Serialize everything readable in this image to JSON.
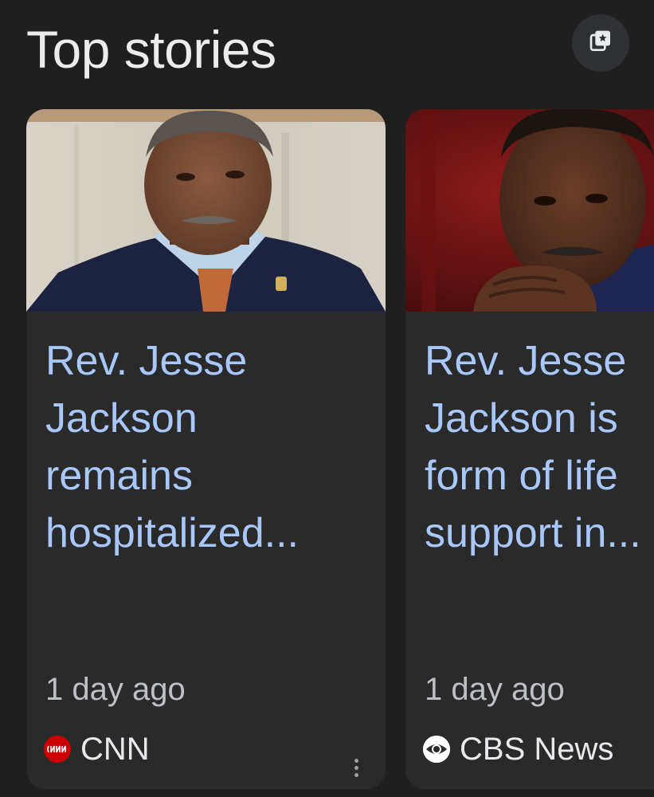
{
  "header": {
    "title": "Top stories",
    "save_icon": "bookmark-star-icon"
  },
  "stories": [
    {
      "headline": "Rev. Jesse\nJackson\nremains\nhospitalized...",
      "time": "1 day ago",
      "source": "CNN",
      "source_logo_text": "CNN",
      "source_logo_color": "#cc0000",
      "more_icon": "more-vert-icon"
    },
    {
      "headline": "Rev. Jesse\nJackson is\nform of life\nsupport in...",
      "time": "1 day ago",
      "source": "CBS News",
      "source_logo_color": "#ffffff"
    }
  ],
  "colors": {
    "background": "#1f1f1f",
    "card": "#2a2a2b",
    "headline": "#a8c7fa",
    "meta": "#bdc1c6"
  }
}
